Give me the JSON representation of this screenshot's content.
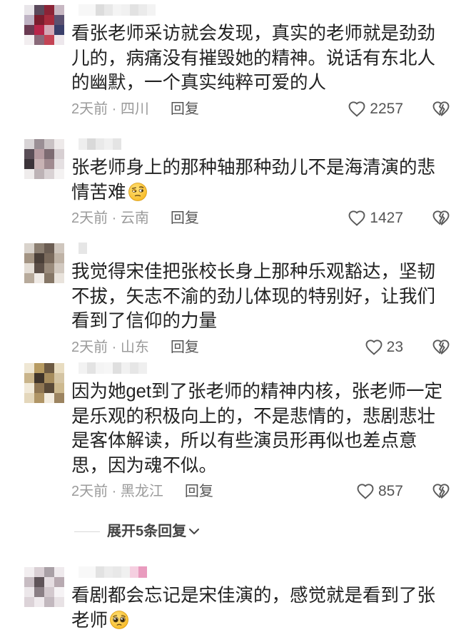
{
  "comments": [
    {
      "avatar_tiles": [
        "#e9e6ea",
        "#5b4a5c",
        "#8b2336",
        "#c7b7c2",
        "#bfb3c4",
        "#7a1d2e",
        "#a72a3c",
        "#5c5170",
        "#6a3a52",
        "#b8254a",
        "#d3a8b6",
        "#3a3f6a",
        "#f2eef0",
        "#8a6a7a",
        "#c44455",
        "#ede7ec"
      ],
      "username_tiles": [
        "#f7f7f7",
        "#f7f7f7",
        "#dcdcdc",
        "#e8e8e8",
        "#f4f4f4",
        "#f1f1f1",
        "#e2e2e2",
        "#ebebeb",
        "#f3f3f3"
      ],
      "lines": [
        "看张老师采访就会发现，真实的老师就是劲劲",
        "儿的，病痛没有摧毁她的精神。说话有东北人",
        "的幽默，一个真实纯粹可爱的人"
      ],
      "time_location": "2天前 · 四川",
      "reply_label": "回复",
      "likes": "2257"
    },
    {
      "avatar_tiles": [
        "#d8d4d6",
        "#9a8f95",
        "#c9c2c4",
        "#eeeaea",
        "#5a4e57",
        "#b59aa0",
        "#7d6b72",
        "#d7cfd2",
        "#3b3339",
        "#c8b2b4",
        "#a08a90",
        "#e5e0e2",
        "#efecec",
        "#bdb3b6",
        "#d9d2d4",
        "#f4f2f2"
      ],
      "username_tiles": [
        "#eeeeee",
        "#d9d9d9",
        "#e9e9e9",
        "#f0f0f0",
        "#e4e4e4"
      ],
      "lines": [
        "张老师身上的那种轴那种劲儿不是海清演的悲",
        "情苦难"
      ],
      "emoji": "skeptical-face-emoji",
      "time_location": "2天前 · 云南",
      "reply_label": "回复",
      "likes": "1427"
    },
    {
      "avatar_tiles": [
        "#d9d3cc",
        "#8c7f72",
        "#6b5d53",
        "#cfc6bd",
        "#a39483",
        "#4a3f38",
        "#7a6a5c",
        "#bfb3a6",
        "#e4ddd5",
        "#5d5048",
        "#9a8b7c",
        "#d2c9c0",
        "#b7aa9b",
        "#efeae5",
        "#857666",
        "#e9e3dc"
      ],
      "username_tiles": [
        "#e6e6e6"
      ],
      "lines": [
        "我觉得宋佳把张校长身上那种乐观豁达，坚韧",
        "不拔，矢志不渝的劲儿体现的特别好，让我们",
        "看到了信仰的力量"
      ],
      "time_location": "2天前 · 山东",
      "reply_label": "回复",
      "likes": "23"
    },
    {
      "avatar_tiles": [
        "#efe7d4",
        "#b79b62",
        "#6d5a43",
        "#e8dcc0",
        "#c9b48a",
        "#3f342a",
        "#a78d5e",
        "#d4c4a3",
        "#f1e9d8",
        "#8f7653",
        "#5a4a38",
        "#cdb98f",
        "#e4d7bb",
        "#b09566",
        "#f3ecdf",
        "#9c8460"
      ],
      "username_tiles": [
        "#f2f2f2",
        "#e3e3e3",
        "#f4f4f4",
        "#f6f6f6",
        "#dfdfdf",
        "#f1f1f1",
        "#e6e6e6",
        "#efefef"
      ],
      "lines": [
        "因为她get到了张老师的精神内核，张老师一定",
        "是乐观的积极向上的，不是悲情的，悲剧悲壮",
        "是客体解读，所以有些演员形再似也差点意",
        "思，因为魂不似。"
      ],
      "time_location": "2天前 · 黑龙江",
      "reply_label": "回复",
      "likes": "857"
    },
    {
      "avatar_tiles": [
        "#f2eef0",
        "#d9cfd4",
        "#a9a0a6",
        "#efeaed",
        "#c7bcc2",
        "#5f5459",
        "#e5dde1",
        "#b8aab1",
        "#ece7ea",
        "#8a7f85",
        "#d3c9ce",
        "#f6f3f5",
        "#dcd3d8",
        "#f0ebee",
        "#c2b8be",
        "#e8e2e5"
      ],
      "username_tiles": [
        "#f8f8f8",
        "#f8f8f8",
        "#e2e2e2",
        "#ececec",
        "#e8e8e8",
        "#f0f0f0",
        "#f5cfe0",
        "#e99bbe"
      ],
      "lines": [
        "看剧都会忘记是宋佳演的，感觉就是看到了张",
        "老师"
      ],
      "emoji": "pleading-face-emoji"
    }
  ],
  "expand_replies": {
    "label": "展开5条回复",
    "icon": "chevron-down-icon"
  },
  "icons": {
    "like": "heart-icon",
    "dislike": "broken-heart-icon"
  },
  "colors": {
    "text": "#222222",
    "meta": "#9b9b9b",
    "reply": "#555555",
    "icon": "#5a5a5a",
    "divider": "#d9d9d9",
    "emoji_yellow": "#ffcc33"
  }
}
